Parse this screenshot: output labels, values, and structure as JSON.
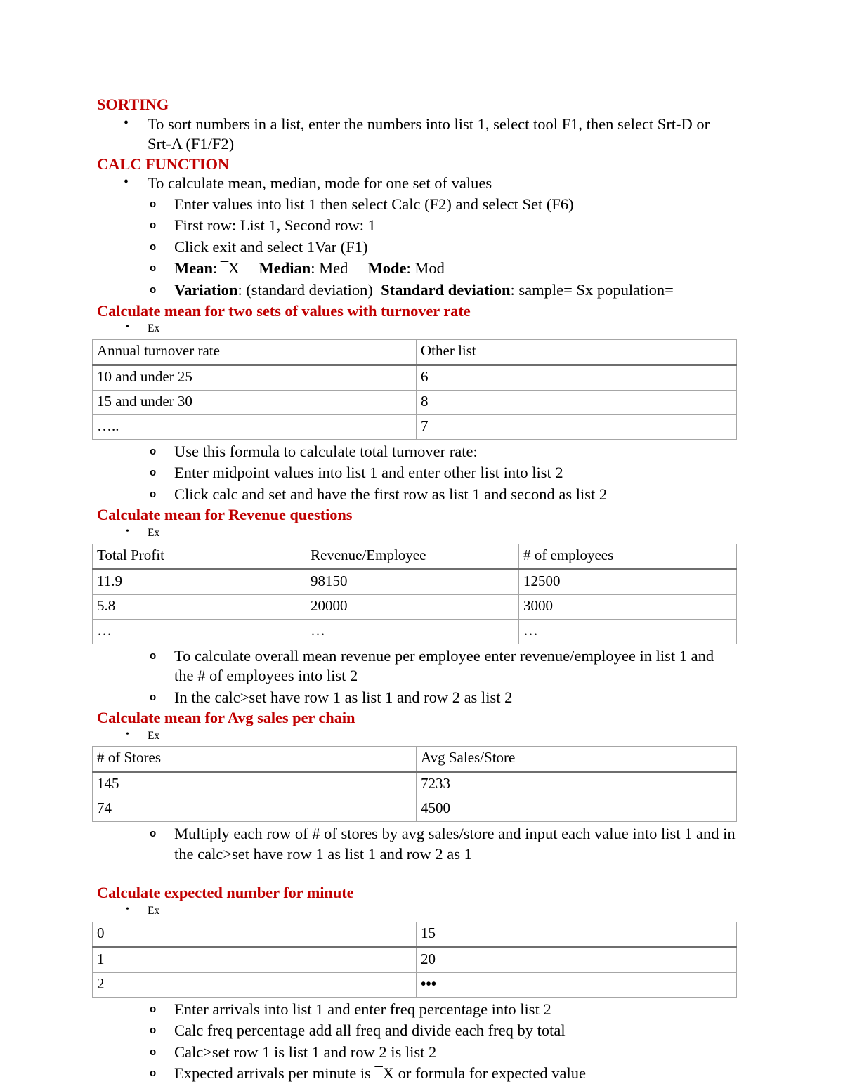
{
  "document": {
    "accent_color": "#C00000",
    "sections": [
      {
        "heading": "SORTING",
        "bullets_l1": [
          "To sort numbers in a list, enter the numbers into list 1, select tool F1, then select Srt-D or Srt-A (F1/F2)"
        ]
      },
      {
        "heading": "CALC FUNCTION",
        "bullet_l1": "To calculate mean, median, mode for one set of values",
        "bullets_l2": [
          "Enter values into list 1 then select Calc (F2) and select Set (F6)",
          "First row: List 1, Second row: 1",
          "Click exit and select 1Var (F1)"
        ],
        "mean_line": {
          "mean_label": "Mean",
          "mean_value": ": ¯X",
          "median_label": "Median",
          "median_value": ": Med",
          "mode_label": "Mode",
          "mode_value": ": Mod"
        },
        "variation_line": {
          "variation_label": "Variation",
          "variation_value": ": (standard deviation)",
          "stdev_label": "Standard deviation",
          "stdev_value": ": sample= Sx   population="
        }
      },
      {
        "heading": "Calculate mean for two sets of values with turnover rate",
        "ex_label": "Ex",
        "table": {
          "headers": [
            "Annual turnover rate",
            "Other list"
          ],
          "rows": [
            [
              "10 and under 25",
              "6"
            ],
            [
              "15 and under 30",
              "8"
            ],
            [
              "…..",
              "7"
            ]
          ]
        },
        "bullets_l2": [
          "Use this formula to calculate total turnover rate:",
          "Enter midpoint values into list 1 and enter other list into list 2",
          "Click calc and set and have the first row as list 1 and second as list 2"
        ]
      },
      {
        "heading": "Calculate mean for Revenue questions",
        "ex_label": "Ex",
        "table": {
          "headers": [
            "Total Profit",
            "Revenue/Employee",
            "# of employees"
          ],
          "rows": [
            [
              "11.9",
              "98150",
              "12500"
            ],
            [
              "5.8",
              "20000",
              "3000"
            ],
            [
              "…",
              "…",
              "…"
            ]
          ]
        },
        "bullets_l2": [
          "To calculate overall mean revenue per employee enter revenue/employee in list 1 and the # of employees into list 2",
          "In the calc>set have row 1 as list 1 and row 2 as list 2"
        ]
      },
      {
        "heading": "Calculate mean for Avg sales per chain",
        "ex_label": "Ex",
        "table": {
          "headers": [
            "# of Stores",
            "Avg Sales/Store"
          ],
          "rows": [
            [
              "145",
              "7233"
            ],
            [
              "74",
              "4500"
            ]
          ]
        },
        "bullets_l2": [
          "Multiply each row of # of stores by avg sales/store and input each value into list 1 and in the calc>set have row 1 as list 1 and row 2 as 1"
        ]
      },
      {
        "heading": "Calculate expected number for minute",
        "ex_label": "Ex",
        "table": {
          "headers": [
            "0",
            "15"
          ],
          "rows": [
            [
              "1",
              "20"
            ],
            [
              "2",
              "•••"
            ]
          ]
        },
        "bullets_l2": [
          "Enter arrivals into list 1 and enter freq percentage into list 2",
          "Calc freq percentage add all freq and divide each freq by total",
          "Calc>set row 1 is list 1 and row 2 is list 2",
          "Expected arrivals per minute is ¯X or formula for expected value"
        ]
      }
    ]
  }
}
